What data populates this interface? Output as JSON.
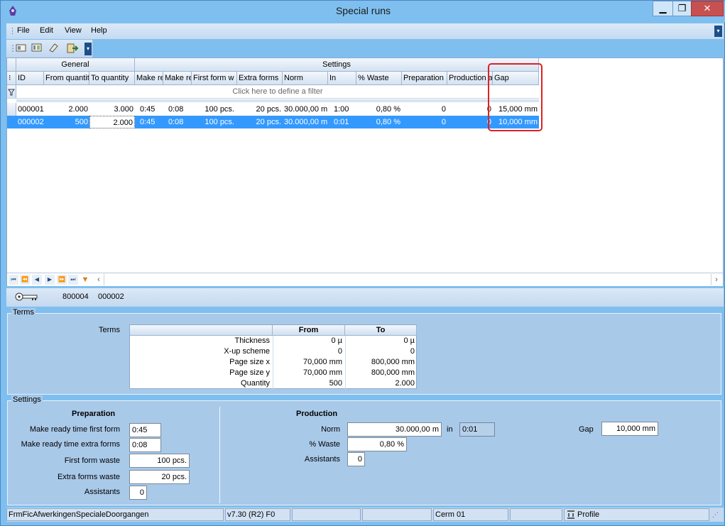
{
  "window": {
    "title": "Special runs"
  },
  "menu": [
    "File",
    "Edit",
    "View",
    "Help"
  ],
  "grid": {
    "bands": {
      "general": "General",
      "settings": "Settings"
    },
    "columns": [
      "ID",
      "From quantit",
      "To quantity",
      "Make re",
      "Make re",
      "First form w",
      "Extra forms",
      "Norm",
      "In",
      "% Waste",
      "Preparation",
      "Production a",
      "Gap"
    ],
    "filter_text": "Click here to define a filter",
    "rows": [
      [
        "000001",
        "2.000",
        "3.000",
        "0:45",
        "0:08",
        "100 pcs.",
        "20 pcs.",
        "30.000,00 m",
        "1:00",
        "0,80 %",
        "0",
        "0",
        "15,000 mm"
      ],
      [
        "000002",
        "500",
        "2.000",
        "0:45",
        "0:08",
        "100 pcs.",
        "20 pcs.",
        "30.000,00 m",
        "0:01",
        "0,80 %",
        "0",
        "0",
        "10,000 mm"
      ]
    ],
    "selected_row": 1
  },
  "key_strip": {
    "key1": "800004",
    "key2": "000002"
  },
  "terms": {
    "group_title": "Terms",
    "label": "Terms",
    "headers": {
      "from": "From",
      "to": "To"
    },
    "rows": [
      {
        "name": "Thickness",
        "from": "0 µ",
        "to": "0 µ"
      },
      {
        "name": "X-up scheme",
        "from": "0",
        "to": "0"
      },
      {
        "name": "Page size x",
        "from": "70,000 mm",
        "to": "800,000 mm"
      },
      {
        "name": "Page size y",
        "from": "70,000 mm",
        "to": "800,000 mm"
      },
      {
        "name": "Quantity",
        "from": "500",
        "to": "2.000"
      }
    ]
  },
  "settings": {
    "group_title": "Settings",
    "preparation": {
      "title": "Preparation",
      "make_ready_first_label": "Make ready time first form",
      "make_ready_first": "0:45",
      "make_ready_extra_label": "Make ready time extra forms",
      "make_ready_extra": "0:08",
      "first_form_waste_label": "First form waste",
      "first_form_waste": "100 pcs.",
      "extra_forms_waste_label": "Extra forms waste",
      "extra_forms_waste": "20 pcs.",
      "assistants_label": "Assistants",
      "assistants": "0"
    },
    "production": {
      "title": "Production",
      "norm_label": "Norm",
      "norm": "30.000,00 m",
      "in_label": "in",
      "in": "0:01",
      "waste_label": "% Waste",
      "waste": "0,80 %",
      "assistants_label": "Assistants",
      "assistants": "0",
      "gap_label": "Gap",
      "gap": "10,000 mm"
    }
  },
  "statusbar": {
    "form": "FrmFicAfwerkingenSpecialeDoorgangen",
    "version": "v7.30 (R2) F0",
    "user": "Cerm 01",
    "profile": "Profile"
  },
  "colors": {
    "selection": "#3399ff",
    "highlight": "#e02020",
    "background": "#a9c9e9"
  }
}
